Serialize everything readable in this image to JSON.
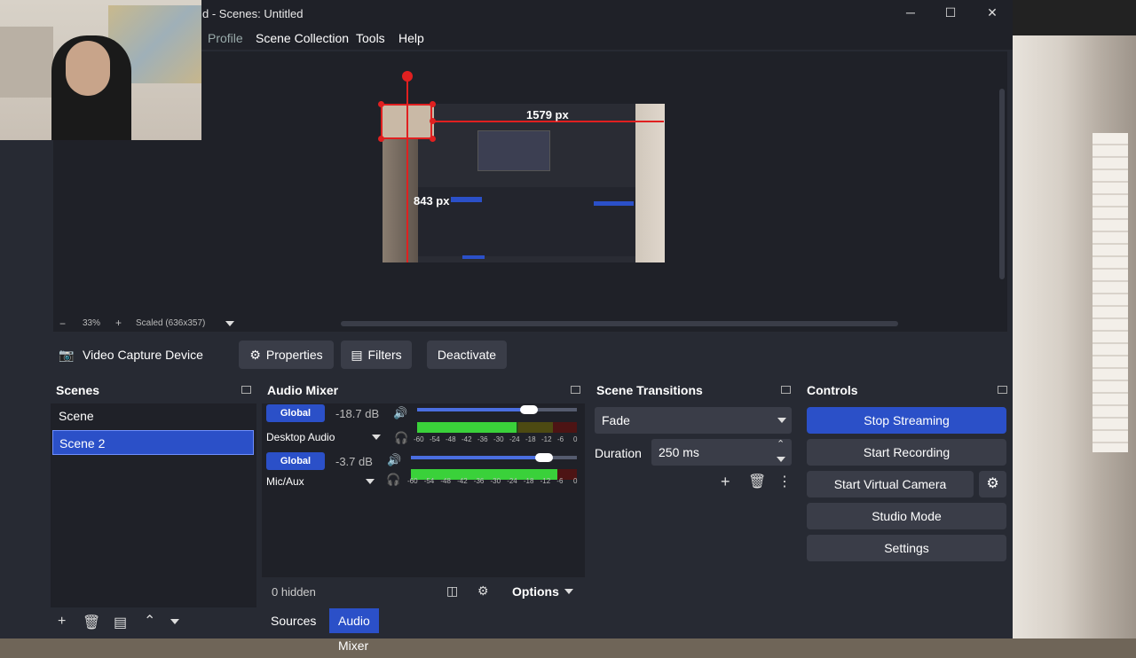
{
  "window": {
    "title": "d - Scenes: Untitled",
    "minimize": "─",
    "maximize": "☐",
    "close": "✕"
  },
  "menu": [
    "Profile",
    "Scene Collection",
    "Tools",
    "Help"
  ],
  "preview": {
    "width_label": "1579 px",
    "height_label": "843 px"
  },
  "zoom": {
    "minus": "−",
    "level": "33%",
    "plus": "+",
    "scaled": "Scaled (636x357)"
  },
  "source_toolbar": {
    "source_name": "Video Capture Device",
    "properties": "Properties",
    "filters": "Filters",
    "deactivate": "Deactivate"
  },
  "scenes": {
    "title": "Scenes",
    "items": [
      "Scene",
      "Scene 2"
    ],
    "selected": "Scene 2"
  },
  "mixer": {
    "title": "Audio Mixer",
    "channels": [
      {
        "global": "Global",
        "db": "-18.7 dB",
        "name": "Desktop Audio",
        "volume_pct": 0.7,
        "meter_pct": 0.62
      },
      {
        "global": "Global",
        "db": "-3.7 dB",
        "name": "Mic/Aux",
        "volume_pct": 0.8,
        "meter_pct": 0.88
      }
    ],
    "scale": [
      "-60",
      "-54",
      "-48",
      "-42",
      "-36",
      "-30",
      "-24",
      "-18",
      "-12",
      "-6",
      "0"
    ],
    "hidden": "0 hidden",
    "options": "Options"
  },
  "tabs": {
    "sources": "Sources",
    "audio_mixer": "Audio Mixer"
  },
  "transitions": {
    "title": "Scene Transitions",
    "selected": "Fade",
    "duration_label": "Duration",
    "duration_value": "250 ms"
  },
  "controls": {
    "title": "Controls",
    "stop_streaming": "Stop Streaming",
    "start_recording": "Start Recording",
    "start_virtual_camera": "Start Virtual Camera",
    "studio_mode": "Studio Mode",
    "settings": "Settings"
  },
  "colors": {
    "accent": "#2b50c8",
    "panel": "#272a33",
    "dark": "#1f2128",
    "marker": "#e02020"
  }
}
